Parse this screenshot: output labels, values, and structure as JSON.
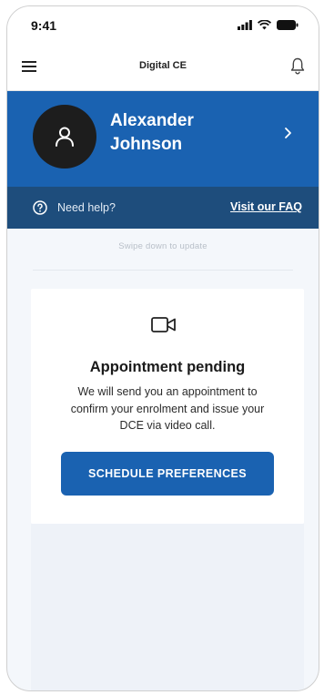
{
  "status_bar": {
    "time": "9:41"
  },
  "header": {
    "title": "Digital CE"
  },
  "profile": {
    "first_name": "Alexander",
    "last_name": "Johnson"
  },
  "help_bar": {
    "question": "Need help?",
    "faq_link": "Visit our FAQ"
  },
  "sub_note": "Swipe down to update",
  "appointment_card": {
    "title": "Appointment pending",
    "body": "We will send you an appointment to confirm your enrolment and issue your DCE via video call.",
    "button_label": "SCHEDULE PREFERENCES"
  },
  "colors": {
    "primary": "#1a62b1",
    "help_bar": "#1e4d7c",
    "avatar": "#1d1d1d"
  }
}
